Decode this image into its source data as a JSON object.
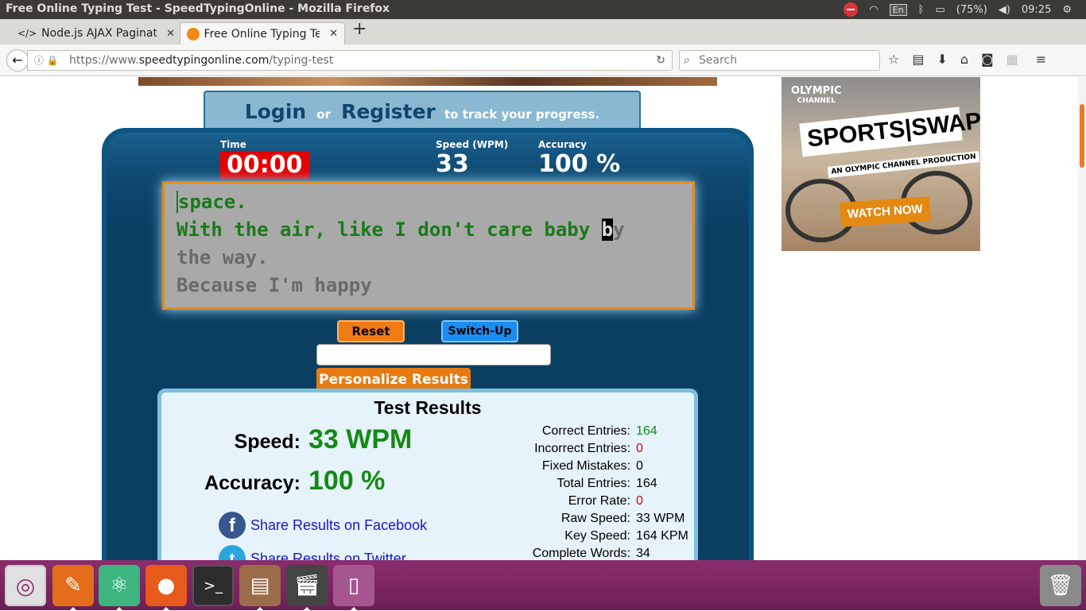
{
  "window": {
    "title": "Free Online Typing Test - SpeedTypingOnline - Mozilla Firefox"
  },
  "tray": {
    "lang": "En",
    "battery": "(75%)",
    "clock": "09:25"
  },
  "tabs": [
    {
      "label": "Node.js AJAX Paginati",
      "close": "✕"
    },
    {
      "label": "Free Online Typing Tes",
      "close": "✕"
    }
  ],
  "nav": {
    "url_prefix": "https://www.",
    "url_domain": "speedtypingonline.com",
    "url_path": "/typing-test",
    "search_placeholder": "Search"
  },
  "login": {
    "login": "Login",
    "or": "or",
    "register": "Register",
    "tail": "to track your progress."
  },
  "stats": {
    "time_label": "Time",
    "time_value": "00:00",
    "speed_label": "Speed (WPM)",
    "speed_value": "33",
    "accuracy_label": "Accuracy",
    "accuracy_value": "100 %"
  },
  "typing": {
    "line1": "space.",
    "line2_typed": "With the air, like I don't care baby ",
    "line2_current": "b",
    "line2_rest": "y",
    "line3": "the way.",
    "line4": "Because I'm happy"
  },
  "buttons": {
    "reset": "Reset",
    "switch_up": "Switch-Up",
    "personalize": "Personalize Results"
  },
  "results": {
    "title": "Test Results",
    "speed_label": "Speed:",
    "speed_value": "33 WPM",
    "accuracy_label": "Accuracy:",
    "accuracy_value": "100 %",
    "share_facebook": "Share Results on Facebook",
    "share_twitter": "Share Results on Twitter",
    "details": [
      {
        "label": "Correct Entries:",
        "value": "164",
        "color": "#138a13"
      },
      {
        "label": "Incorrect Entries:",
        "value": "0",
        "color": "#e00000"
      },
      {
        "label": "Fixed Mistakes:",
        "value": "0",
        "color": "#000000"
      },
      {
        "label": "Total Entries:",
        "value": "164",
        "color": "#000000"
      },
      {
        "label": "Error Rate:",
        "value": "0",
        "color": "#e00000"
      },
      {
        "label": "Raw Speed:",
        "value": "33 WPM",
        "color": "#000000"
      },
      {
        "label": "Key Speed:",
        "value": "164 KPM",
        "color": "#000000"
      },
      {
        "label": "Complete Words:",
        "value": "34",
        "color": "#000000"
      }
    ]
  },
  "ad": {
    "brand": "OLYMPIC",
    "brand_sub": "CHANNEL",
    "headline": "SPORTS|SWAP",
    "production": "AN OLYMPIC CHANNEL PRODUCTION",
    "cta": "WATCH NOW"
  },
  "dock": [
    "ubuntu-icon",
    "pencil-icon",
    "atom-icon",
    "firefox-icon",
    "terminal-icon",
    "files-icon",
    "video-editor-icon",
    "usb-icon",
    "trash-icon"
  ]
}
